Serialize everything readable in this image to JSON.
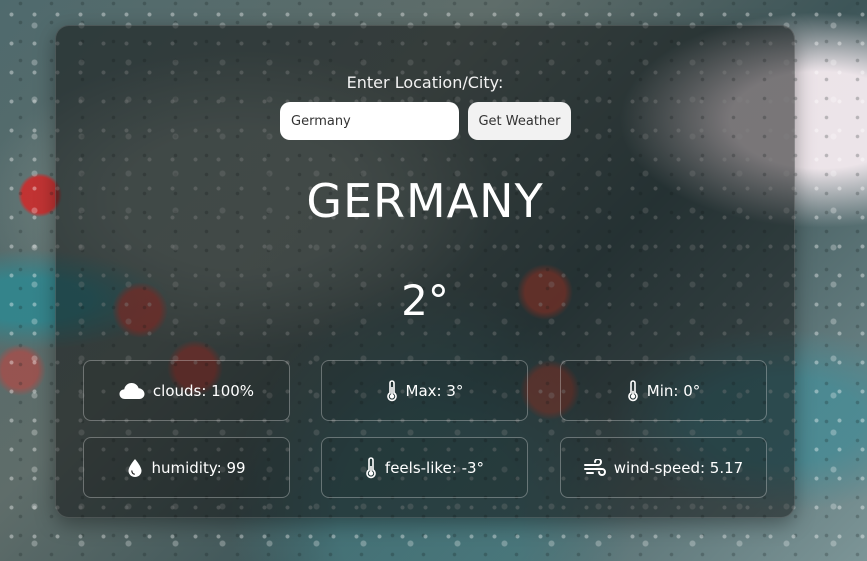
{
  "header": {
    "prompt_label": "Enter Location/City:"
  },
  "search": {
    "value": "Germany",
    "button_label": "Get Weather"
  },
  "weather": {
    "city": "GERMANY",
    "temperature": "2°"
  },
  "stats": [
    {
      "icon": "cloud-icon",
      "text": "clouds: 100%"
    },
    {
      "icon": "thermometer-icon",
      "text": "Max: 3°"
    },
    {
      "icon": "thermometer-icon",
      "text": "Min: 0°"
    },
    {
      "icon": "water-drop-icon",
      "text": "humidity: 99"
    },
    {
      "icon": "thermometer-icon",
      "text": "feels-like: -3°"
    },
    {
      "icon": "wind-icon",
      "text": "wind-speed: 5.17"
    }
  ]
}
